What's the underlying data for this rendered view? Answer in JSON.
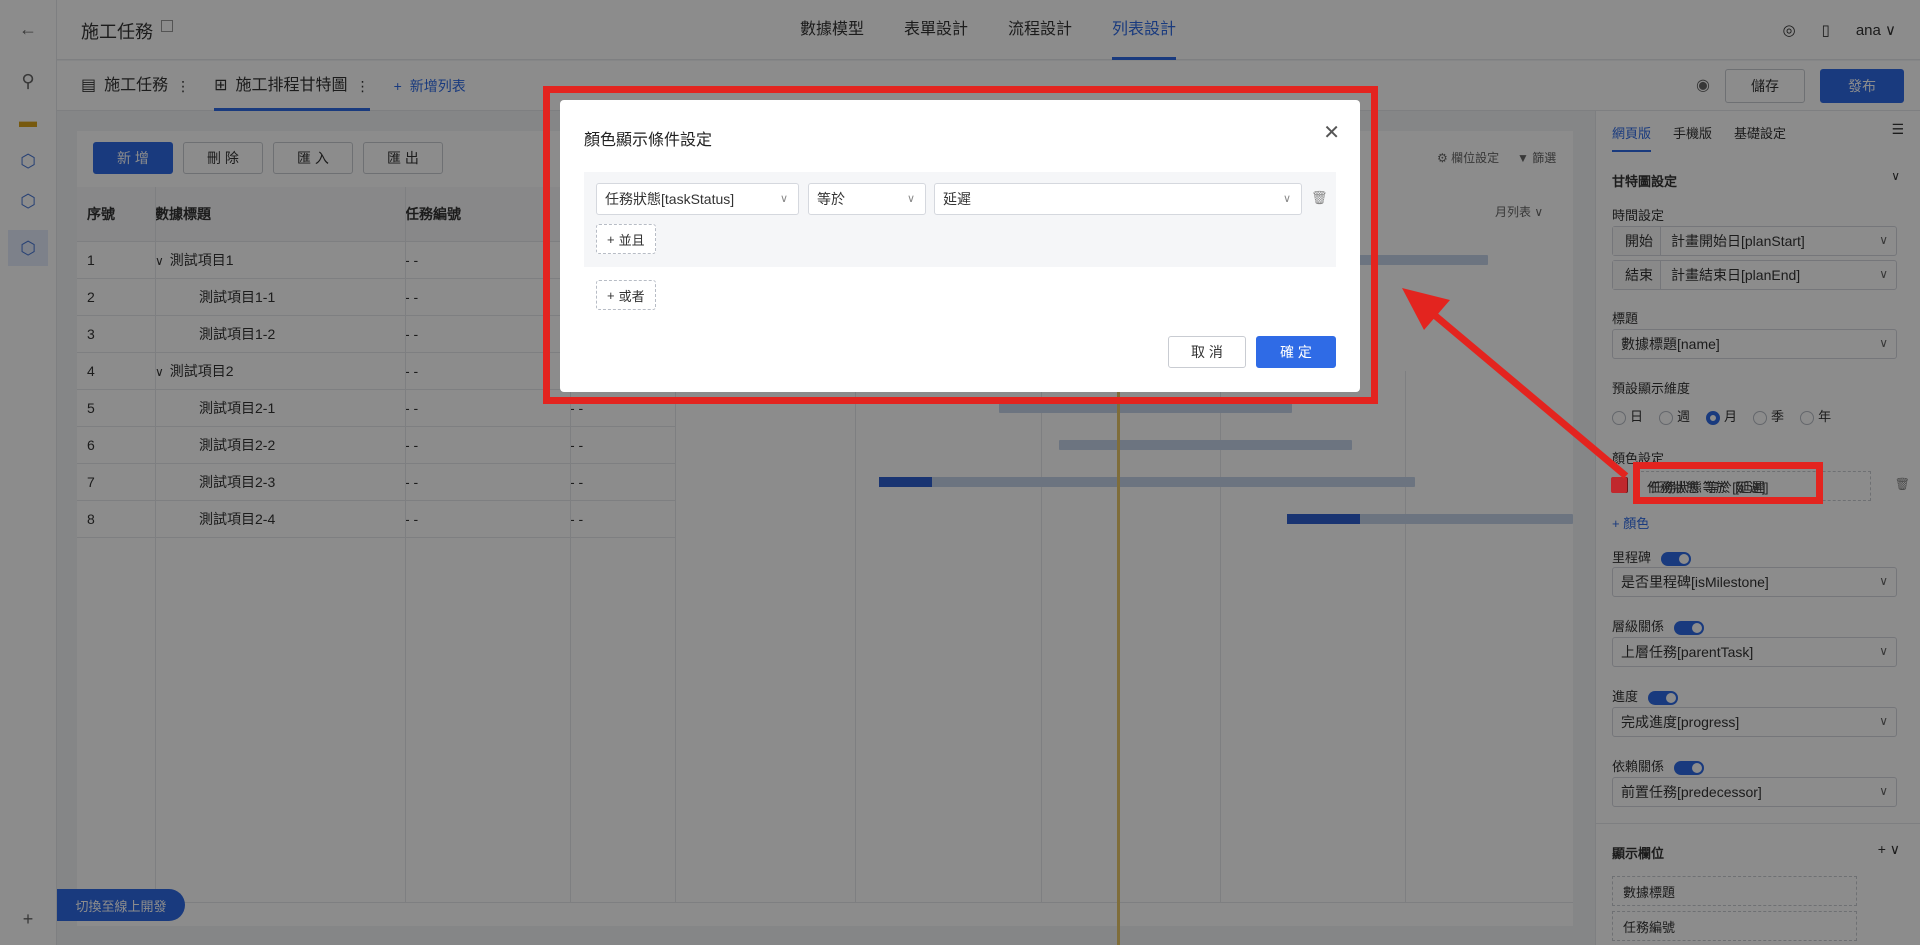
{
  "app": {
    "title": "施工任務"
  },
  "top_nav": [
    "數據模型",
    "表單設計",
    "流程設計",
    "列表設計"
  ],
  "user": "ana",
  "tabs": [
    {
      "label": "施工任務"
    },
    {
      "label": "施工排程甘特圖"
    }
  ],
  "add_list_label": "新增列表",
  "toolbar": {
    "preview": "儲存",
    "publish": "發布",
    "new": "新 增",
    "delete": "刪 除",
    "import": "匯 入",
    "export": "匯 出",
    "column_settings": "欄位設定",
    "filter": "篩選",
    "view": "月列表"
  },
  "table": {
    "headers": [
      "序號",
      "數據標題",
      "任務編號"
    ],
    "rows": [
      {
        "no": "1",
        "title": "測試項目1",
        "code": "- -",
        "level": 0,
        "expand": true
      },
      {
        "no": "2",
        "title": "測試項目1-1",
        "code": "- -",
        "level": 1
      },
      {
        "no": "3",
        "title": "測試項目1-2",
        "code": "- -",
        "level": 1
      },
      {
        "no": "4",
        "title": "測試項目2",
        "code": "- -",
        "level": 0,
        "expand": true
      },
      {
        "no": "5",
        "title": "測試項目2-1",
        "code": "- -",
        "level": 1,
        "extra": "- -"
      },
      {
        "no": "6",
        "title": "測試項目2-2",
        "code": "- -",
        "level": 1,
        "extra": "- -"
      },
      {
        "no": "7",
        "title": "測試項目2-3",
        "code": "- -",
        "level": 1,
        "extra": "- -"
      },
      {
        "no": "8",
        "title": "測試項目2-4",
        "code": "- -",
        "level": 1,
        "extra": "- -"
      }
    ],
    "gantt_progress": [
      0,
      0,
      0,
      0,
      0,
      0,
      0.1,
      0.25
    ]
  },
  "switch_online": "切換至線上開發",
  "config": {
    "tabs": [
      "網頁版",
      "手機版",
      "基礎設定"
    ],
    "section": "甘特圖設定",
    "time_label": "時間設定",
    "start_label": "開始",
    "start_value": "計畫開始日[planStart]",
    "end_label": "結束",
    "end_value": "計畫結束日[planEnd]",
    "title_label": "標題",
    "title_value": "數據標題[name]",
    "dim_label": "預設顯示維度",
    "dims": [
      "日",
      "週",
      "月",
      "季",
      "年"
    ],
    "dim_selected": "月",
    "color_label": "顏色設定",
    "color_rule": "任務狀態 等於 [延遲]",
    "color_swatch": "#c0282d",
    "add_color": "顏色",
    "milestone_label": "里程碑",
    "milestone_value": "是否里程碑[isMilestone]",
    "hierarchy_label": "層級關係",
    "hierarchy_value": "上層任務[parentTask]",
    "progress_label": "進度",
    "progress_value": "完成進度[progress]",
    "dependency_label": "依賴關係",
    "dependency_value": "前置任務[predecessor]",
    "display_fields_label": "顯示欄位",
    "display_fields": [
      "數據標題",
      "任務編號"
    ]
  },
  "dialog": {
    "title": "顏色顯示條件設定",
    "field": "任務狀態[taskStatus]",
    "operator": "等於",
    "value": "延遲",
    "and_label": "並且",
    "or_label": "或者",
    "cancel": "取 消",
    "confirm": "確 定"
  },
  "colors": {
    "accent": "#2f6be6",
    "highlight": "#e3241f"
  }
}
